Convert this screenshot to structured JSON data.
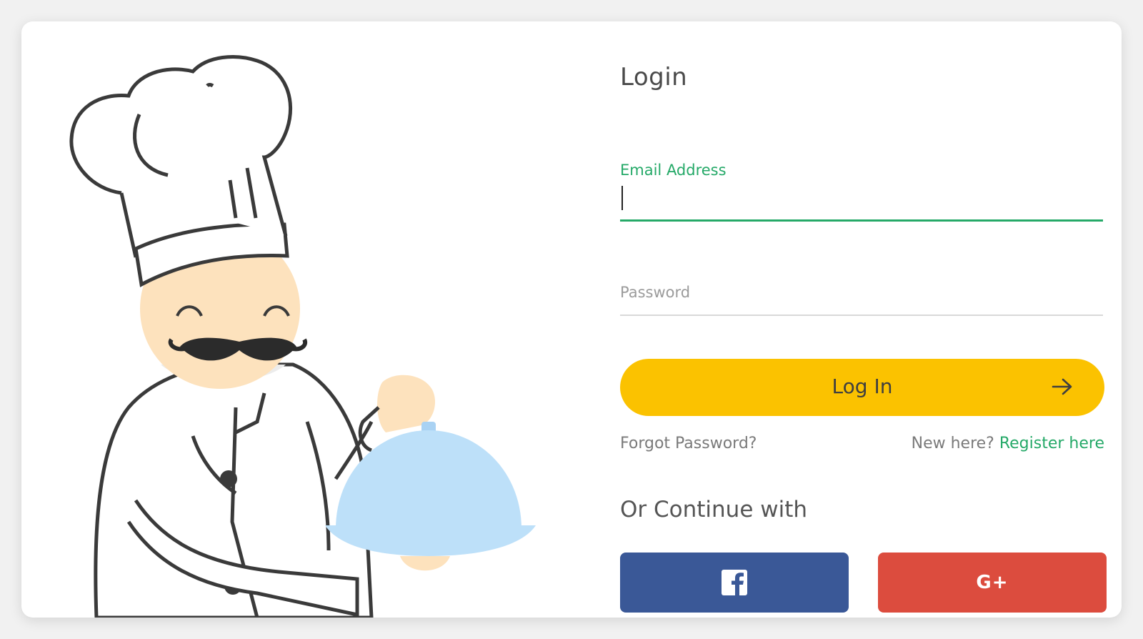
{
  "login": {
    "title": "Login",
    "email": {
      "label": "Email Address",
      "value": ""
    },
    "password": {
      "label": "Password",
      "value": ""
    },
    "submit_label": "Log In",
    "forgot_link": "Forgot Password?",
    "register_prompt": "New here? ",
    "register_link": "Register here",
    "continue_text": "Or Continue with",
    "social": [
      {
        "name": "facebook",
        "icon": "facebook-icon",
        "color": "#3a5897"
      },
      {
        "name": "google-plus",
        "icon": "google-plus-icon",
        "glyph": "G+",
        "color": "#dc4c3e"
      }
    ]
  },
  "colors": {
    "accent_green": "#25a968",
    "button_yellow": "#fbc200",
    "muted_text": "#7a7a7a"
  },
  "illustration": {
    "subject": "chef-illustration"
  }
}
